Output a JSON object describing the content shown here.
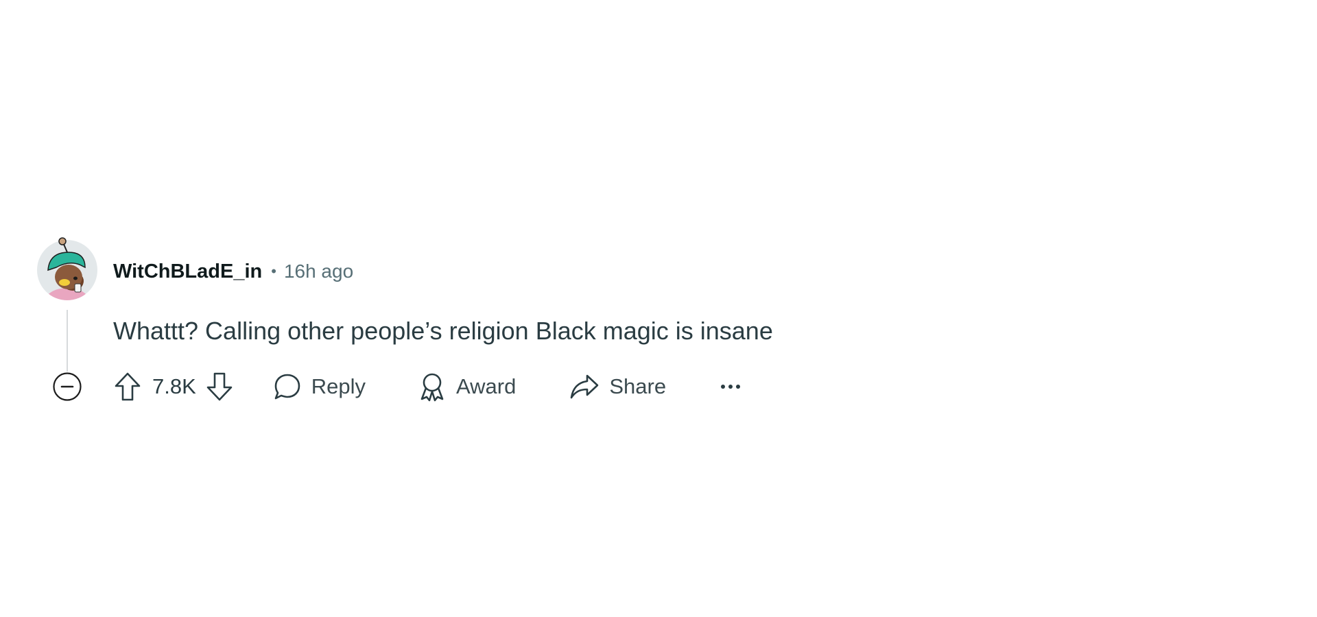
{
  "comment": {
    "author": "WitChBLadE_in",
    "separator": "•",
    "timestamp": "16h ago",
    "body": "Whattt? Calling other people’s religion Black magic is insane",
    "score": "7.8K"
  },
  "actions": {
    "reply_label": "Reply",
    "award_label": "Award",
    "share_label": "Share"
  },
  "icons": {
    "avatar": "snoo-avatar-icon",
    "collapse": "collapse-minus-icon",
    "upvote": "upvote-arrow-icon",
    "downvote": "downvote-arrow-icon",
    "reply": "speech-bubble-icon",
    "award": "award-ribbon-icon",
    "share": "share-arrow-icon",
    "more": "ellipsis-icon"
  },
  "colors": {
    "text_primary": "#0f1a1c",
    "text_secondary": "#576f76",
    "body_text": "#2a3c42",
    "avatar_hat": "#2bb59b",
    "avatar_skin": "#8b5a3c"
  }
}
